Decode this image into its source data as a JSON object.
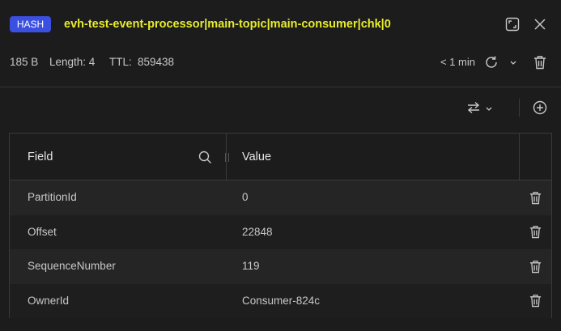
{
  "header": {
    "type_badge": "HASH",
    "key_name": "evh-test-event-processor|main-topic|main-consumer|chk|0",
    "size": "185 B",
    "length_label": "Length: 4",
    "ttl_label": "TTL:",
    "ttl_value": "859438",
    "refresh_time": "< 1 min"
  },
  "table": {
    "columns": [
      "Field",
      "Value"
    ],
    "rows": [
      {
        "field": "PartitionId",
        "value": "0"
      },
      {
        "field": "Offset",
        "value": "22848"
      },
      {
        "field": "SequenceNumber",
        "value": "119"
      },
      {
        "field": "OwnerId",
        "value": "Consumer-824c"
      }
    ]
  },
  "colors": {
    "background": "#1c1c1c",
    "badge": "#3b4fe0",
    "key_name": "#e7ec2c"
  },
  "icons": [
    "fullscreen-icon",
    "close-icon",
    "refresh-icon",
    "chevron-down-icon",
    "delete-icon",
    "swap-arrows-icon",
    "add-icon",
    "search-icon"
  ]
}
